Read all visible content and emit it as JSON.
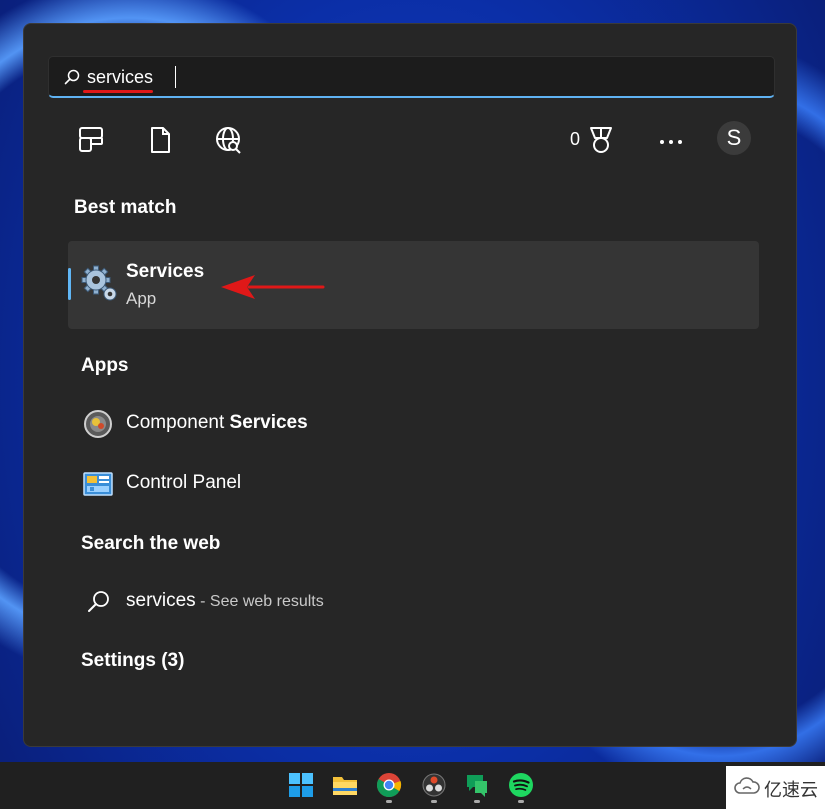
{
  "search": {
    "query": "services"
  },
  "toolbar": {
    "points": "0",
    "avatar_letter": "S"
  },
  "best_match": {
    "title": "Best match",
    "item": {
      "name": "Services",
      "type": "App"
    }
  },
  "apps": {
    "title": "Apps",
    "items": [
      {
        "prefix": "Component ",
        "highlight": "Services"
      },
      {
        "prefix": "Control Panel",
        "highlight": ""
      }
    ]
  },
  "web": {
    "title": "Search the web",
    "query": "services",
    "hint": " - See web results"
  },
  "settings": {
    "title": "Settings (3)"
  },
  "watermark": {
    "text": "亿速云"
  },
  "colors": {
    "accent": "#60b6f5",
    "panel": "#262626",
    "annotation": "#e01818"
  },
  "taskbar_icons": [
    "windows-icon",
    "file-explorer-icon",
    "chrome-icon",
    "davinci-icon",
    "chat-icon",
    "spotify-icon"
  ]
}
